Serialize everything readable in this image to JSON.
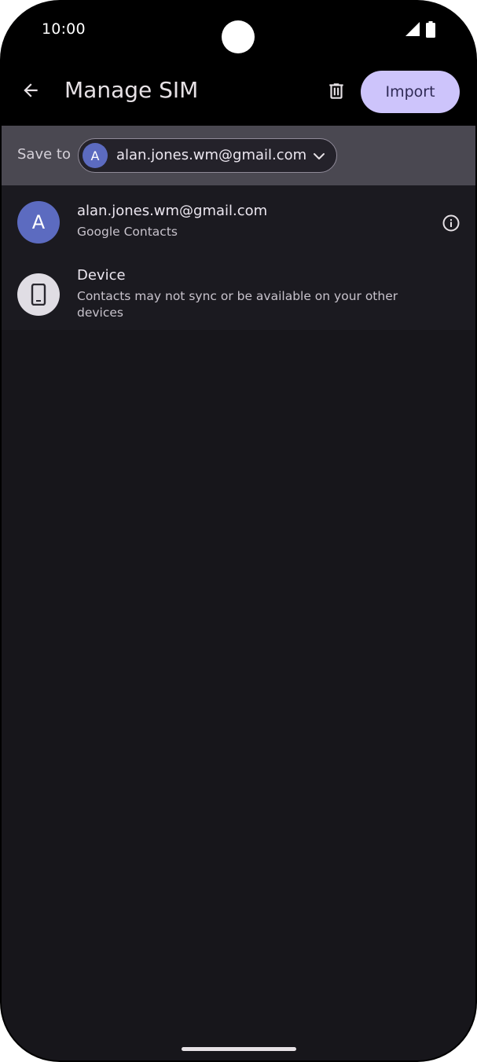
{
  "status_bar": {
    "time": "10:00"
  },
  "app_bar": {
    "title": "Manage SIM",
    "import_label": "Import"
  },
  "save_to": {
    "label": "Save to",
    "account_initial": "A",
    "account_email": "alan.jones.wm@gmail.com"
  },
  "list": {
    "items": [
      {
        "initial": "A",
        "title": "alan.jones.wm@gmail.com",
        "subtitle": "Google Contacts"
      },
      {
        "title": "Device",
        "subtitle": "Contacts may not sync or be available on your other devices"
      }
    ]
  },
  "colors": {
    "accent": "#cdc4fb",
    "avatar": "#5c6bc0",
    "background": "#17161b",
    "save_to_bar": "#4a4851"
  },
  "icons": {
    "back": "arrow-back-icon",
    "delete": "trash-icon",
    "chevron": "chevron-down-icon",
    "info": "info-icon",
    "device": "phone-icon",
    "signal": "signal-icon",
    "battery": "battery-icon"
  }
}
